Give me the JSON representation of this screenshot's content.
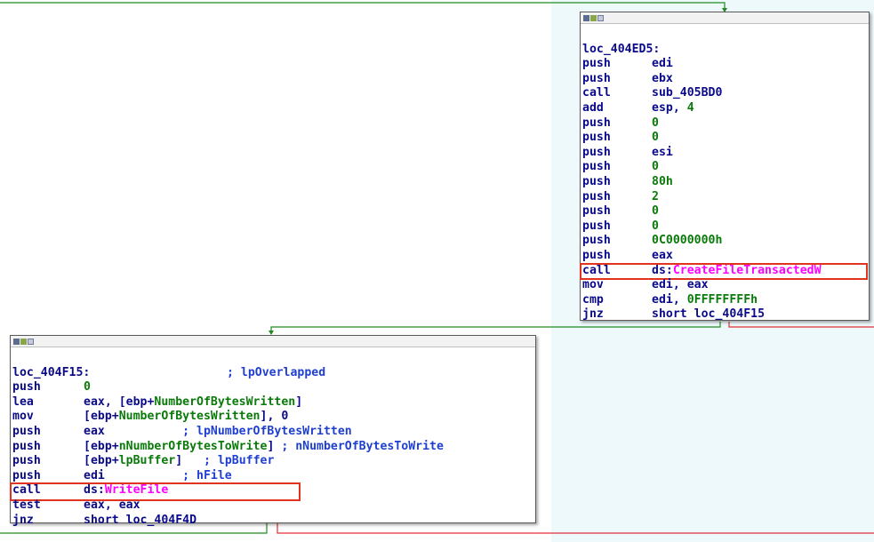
{
  "block1": {
    "header_icons": [
      "graph-icon",
      "chart-icon",
      "window-icon"
    ],
    "label": "loc_404ED5:",
    "instructions": [
      {
        "mnemonic": "push",
        "operands": [
          {
            "t": "edi",
            "k": "reg"
          }
        ]
      },
      {
        "mnemonic": "push",
        "operands": [
          {
            "t": "ebx",
            "k": "reg"
          }
        ]
      },
      {
        "mnemonic": "call",
        "operands": [
          {
            "t": "sub_405BD0",
            "k": "reg"
          }
        ]
      },
      {
        "mnemonic": "add",
        "operands": [
          {
            "t": "esp, ",
            "k": "reg"
          },
          {
            "t": "4",
            "k": "num"
          }
        ]
      },
      {
        "mnemonic": "push",
        "operands": [
          {
            "t": "0",
            "k": "num"
          }
        ]
      },
      {
        "mnemonic": "push",
        "operands": [
          {
            "t": "0",
            "k": "num"
          }
        ]
      },
      {
        "mnemonic": "push",
        "operands": [
          {
            "t": "esi",
            "k": "reg"
          }
        ]
      },
      {
        "mnemonic": "push",
        "operands": [
          {
            "t": "0",
            "k": "num"
          }
        ]
      },
      {
        "mnemonic": "push",
        "operands": [
          {
            "t": "80h",
            "k": "num"
          }
        ]
      },
      {
        "mnemonic": "push",
        "operands": [
          {
            "t": "2",
            "k": "num"
          }
        ]
      },
      {
        "mnemonic": "push",
        "operands": [
          {
            "t": "0",
            "k": "num"
          }
        ]
      },
      {
        "mnemonic": "push",
        "operands": [
          {
            "t": "0",
            "k": "num"
          }
        ]
      },
      {
        "mnemonic": "push",
        "operands": [
          {
            "t": "0C0000000h",
            "k": "num"
          }
        ]
      },
      {
        "mnemonic": "push",
        "operands": [
          {
            "t": "eax",
            "k": "reg"
          }
        ]
      },
      {
        "mnemonic": "call",
        "operands": [
          {
            "t": "ds:",
            "k": "reg"
          },
          {
            "t": "CreateFileTransactedW",
            "k": "api"
          }
        ],
        "highlight": true
      },
      {
        "mnemonic": "mov",
        "operands": [
          {
            "t": "edi, eax",
            "k": "reg"
          }
        ]
      },
      {
        "mnemonic": "cmp",
        "operands": [
          {
            "t": "edi, ",
            "k": "reg"
          },
          {
            "t": "0FFFFFFFFh",
            "k": "num"
          }
        ]
      },
      {
        "mnemonic": "jnz",
        "operands": [
          {
            "t": "short loc_404F15",
            "k": "reg"
          }
        ]
      }
    ]
  },
  "block2": {
    "header_icons": [
      "graph-icon",
      "chart-icon",
      "window-icon"
    ],
    "label": "loc_404F15:",
    "label_comment": "; lpOverlapped",
    "instructions": [
      {
        "mnemonic": "push",
        "operands": [
          {
            "t": "0",
            "k": "num"
          }
        ]
      },
      {
        "mnemonic": "lea",
        "operands": [
          {
            "t": "eax, [ebp+",
            "k": "reg"
          },
          {
            "t": "NumberOfBytesWritten",
            "k": "num"
          },
          {
            "t": "]",
            "k": "reg"
          }
        ]
      },
      {
        "mnemonic": "mov",
        "operands": [
          {
            "t": "[ebp+",
            "k": "reg"
          },
          {
            "t": "NumberOfBytesWritten",
            "k": "num"
          },
          {
            "t": "], 0",
            "k": "reg"
          }
        ]
      },
      {
        "mnemonic": "push",
        "operands": [
          {
            "t": "eax           ",
            "k": "reg"
          },
          {
            "t": "; lpNumberOfBytesWritten",
            "k": "cmt"
          }
        ]
      },
      {
        "mnemonic": "push",
        "operands": [
          {
            "t": "[ebp+",
            "k": "reg"
          },
          {
            "t": "nNumberOfBytesToWrite",
            "k": "num"
          },
          {
            "t": "] ",
            "k": "reg"
          },
          {
            "t": "; nNumberOfBytesToWrite",
            "k": "cmt"
          }
        ]
      },
      {
        "mnemonic": "push",
        "operands": [
          {
            "t": "[ebp+",
            "k": "reg"
          },
          {
            "t": "lpBuffer",
            "k": "num"
          },
          {
            "t": "]   ",
            "k": "reg"
          },
          {
            "t": "; lpBuffer",
            "k": "cmt"
          }
        ]
      },
      {
        "mnemonic": "push",
        "operands": [
          {
            "t": "edi           ",
            "k": "reg"
          },
          {
            "t": "; hFile",
            "k": "cmt"
          }
        ]
      },
      {
        "mnemonic": "call",
        "operands": [
          {
            "t": "ds:",
            "k": "reg"
          },
          {
            "t": "WriteFile",
            "k": "api"
          }
        ],
        "highlight": true
      },
      {
        "mnemonic": "test",
        "operands": [
          {
            "t": "eax, eax",
            "k": "reg"
          }
        ]
      },
      {
        "mnemonic": "jnz",
        "operands": [
          {
            "t": "short loc_404F4D",
            "k": "reg"
          }
        ]
      }
    ]
  },
  "colors": {
    "mnemonic": "#0a0a8a",
    "number": "#0a7a0a",
    "comment": "#1f3fd0",
    "api": "#ff00ff",
    "highlight_box": "#e0341e",
    "edge_true": "#1f8a1f",
    "edge_false": "#e03030"
  }
}
